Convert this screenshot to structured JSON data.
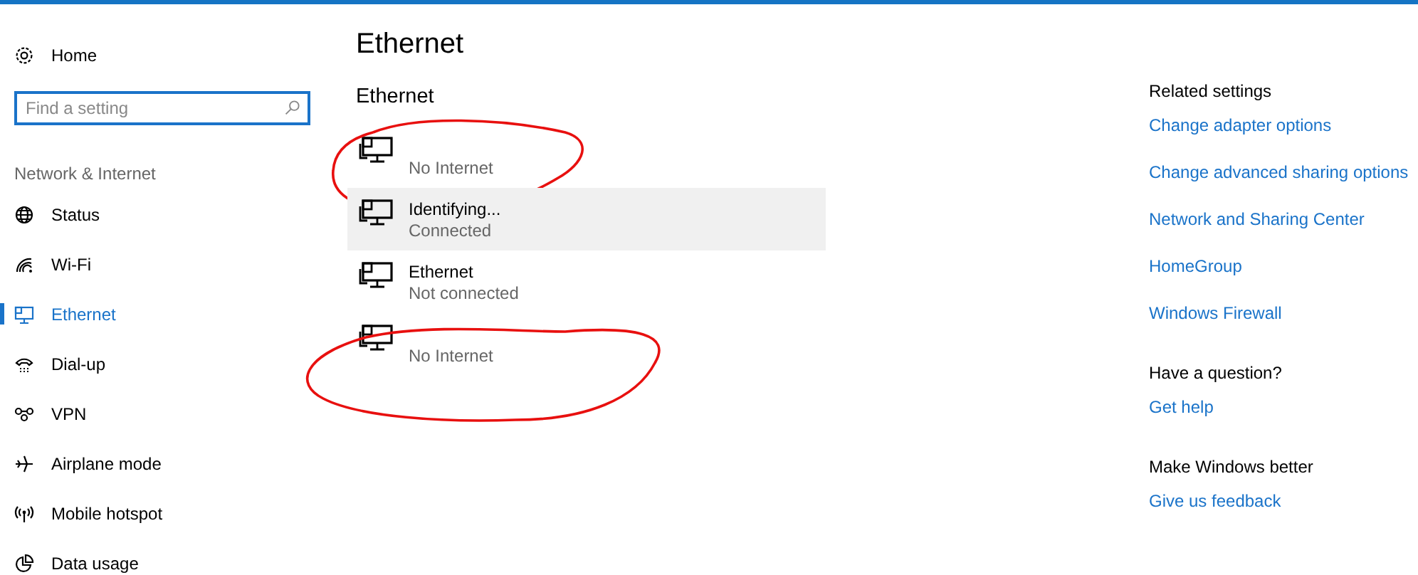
{
  "sidebar": {
    "home": {
      "label": "Home"
    },
    "search": {
      "placeholder": "Find a setting"
    },
    "section": "Network & Internet",
    "items": [
      {
        "label": "Status",
        "selected": false
      },
      {
        "label": "Wi-Fi",
        "selected": false
      },
      {
        "label": "Ethernet",
        "selected": true
      },
      {
        "label": "Dial-up",
        "selected": false
      },
      {
        "label": "VPN",
        "selected": false
      },
      {
        "label": "Airplane mode",
        "selected": false
      },
      {
        "label": "Mobile hotspot",
        "selected": false
      },
      {
        "label": "Data usage",
        "selected": false
      }
    ]
  },
  "page": {
    "title": "Ethernet",
    "subtitle": "Ethernet",
    "networks": [
      {
        "status": "No Internet",
        "hovered": false,
        "circled": true
      },
      {
        "name": "Identifying...",
        "status": "Connected",
        "hovered": true,
        "circled": false
      },
      {
        "name": "Ethernet",
        "status": "Not connected",
        "hovered": false,
        "circled": false
      },
      {
        "status": "No Internet",
        "hovered": false,
        "circled": true
      }
    ]
  },
  "related": [
    {
      "heading": "Related settings",
      "links": [
        "Change adapter options",
        "Change advanced sharing options",
        "Network and Sharing Center",
        "HomeGroup",
        "Windows Firewall"
      ]
    },
    {
      "heading": "Have a question?",
      "links": [
        "Get help"
      ]
    },
    {
      "heading": "Make Windows better",
      "links": [
        "Give us feedback"
      ]
    }
  ]
}
